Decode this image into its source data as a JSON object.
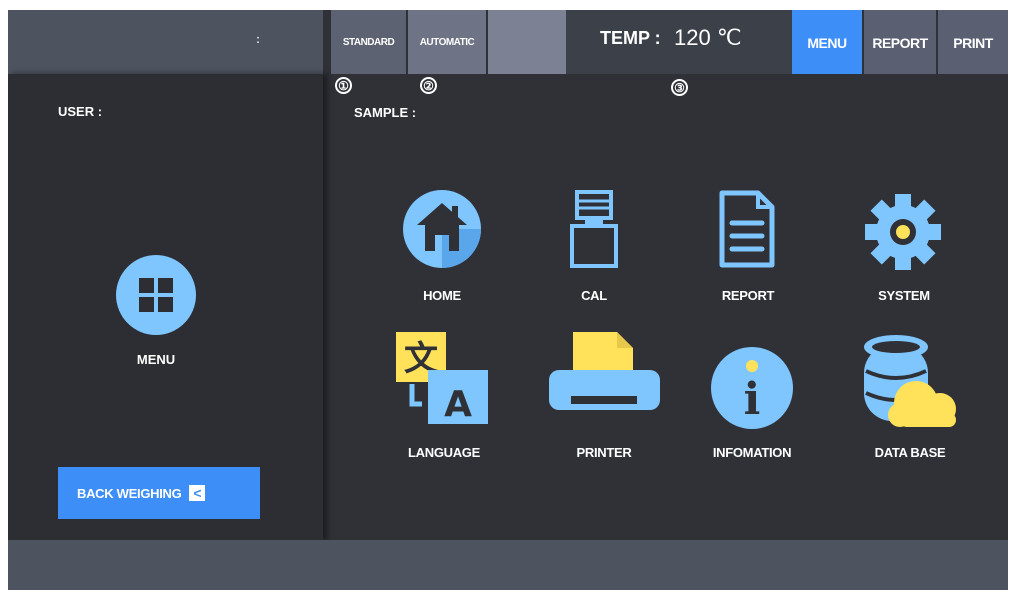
{
  "topbar": {
    "left_colon": ":",
    "modes": {
      "standard": "STANDARD",
      "automatic": "AUTOMATIC"
    },
    "temperature": {
      "label": "TEMP :",
      "value": "120 ℃"
    },
    "nav": {
      "menu": "MENU",
      "report": "REPORT",
      "print": "PRINT",
      "active": "MENU"
    }
  },
  "markers": [
    "①",
    "②",
    "③"
  ],
  "left_panel": {
    "user_label": "USER :",
    "menu_icon": "grid-icon",
    "menu_label": "MENU",
    "back_button": {
      "label": "BACK WEIGHING",
      "icon": "chevron-left-icon",
      "symbol": "<"
    }
  },
  "main": {
    "sample_label": "SAMPLE :",
    "items": [
      {
        "label": "HOME",
        "icon": "home-icon"
      },
      {
        "label": "CAL",
        "icon": "weight-icon"
      },
      {
        "label": "REPORT",
        "icon": "document-icon"
      },
      {
        "label": "SYSTEM",
        "icon": "gear-icon"
      },
      {
        "label": "LANGUAGE",
        "icon": "translate-icon"
      },
      {
        "label": "PRINTER",
        "icon": "printer-icon"
      },
      {
        "label": "INFOMATION",
        "icon": "info-icon"
      },
      {
        "label": "DATA BASE",
        "icon": "database-cloud-icon"
      }
    ]
  },
  "colors": {
    "accent": "#3d8ff7",
    "icon_blue": "#7fc6ff",
    "icon_yellow": "#ffe25a",
    "panel": "#2c2e33",
    "background": "#2f3137",
    "bar": "#4d535f"
  },
  "icon_glyphs": {
    "translate_cjk": "文",
    "translate_latin": "A",
    "info": "i"
  }
}
